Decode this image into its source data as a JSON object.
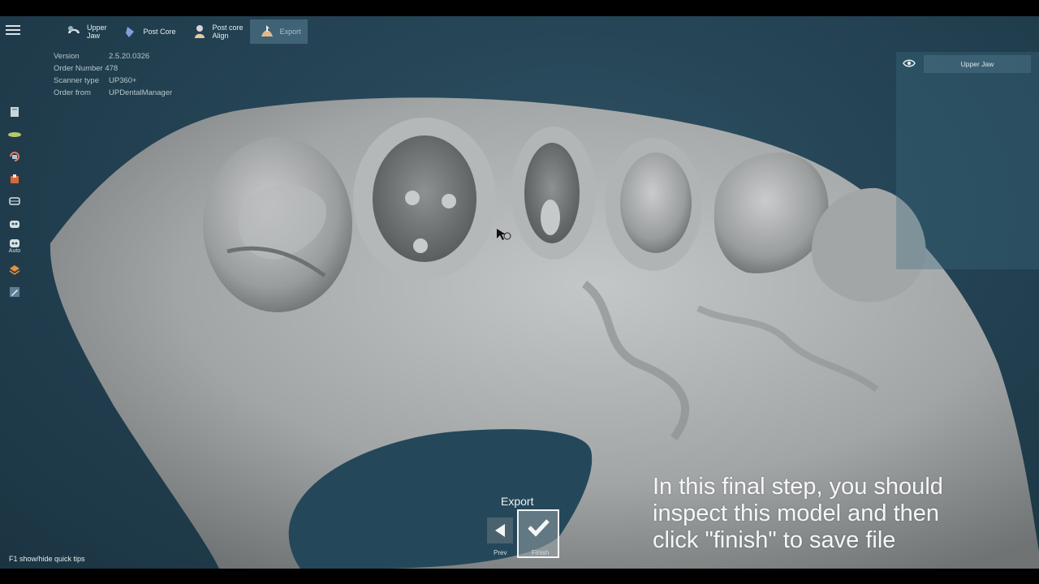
{
  "toolbar": {
    "steps": [
      {
        "label_line1": "Upper",
        "label_line2": "Jaw",
        "icon": "upper-jaw-icon"
      },
      {
        "label_line1": "Post Core",
        "label_line2": "",
        "icon": "post-core-icon"
      },
      {
        "label_line1": "Post core",
        "label_line2": "Align",
        "icon": "post-core-align-icon"
      },
      {
        "label_line1": "Export",
        "label_line2": "",
        "icon": "export-icon"
      }
    ],
    "active_step": "Export"
  },
  "info": {
    "version_label": "Version",
    "version_value": "2.5.20.0326",
    "order_label": "Order Number",
    "order_value": "478",
    "scanner_label": "Scanner type",
    "scanner_value": "UP360+",
    "from_label": "Order from",
    "from_value": "UPDentalManager"
  },
  "tools": {
    "auto_label": "Auto",
    "icons": [
      "file-icon",
      "plane-icon",
      "rotate-icon",
      "paint-icon",
      "jaw-icon",
      "mask-icon",
      "auto-icon",
      "layer-icon",
      "edit-icon"
    ]
  },
  "right_panel": {
    "layer_label": "Upper Jaw",
    "icon": "eye-icon"
  },
  "bottom": {
    "title": "Export",
    "prev_label": "Prev",
    "finish_label": "Finish"
  },
  "caption": {
    "line1": "In this final step, you should",
    "line2": "inspect this model and then",
    "line3": "click \"finish\" to save file"
  },
  "tips": "F1 show/hide quick tips",
  "colors": {
    "background": "#244354",
    "model": "#a6a9aa",
    "accent": "#a9c2d0"
  }
}
